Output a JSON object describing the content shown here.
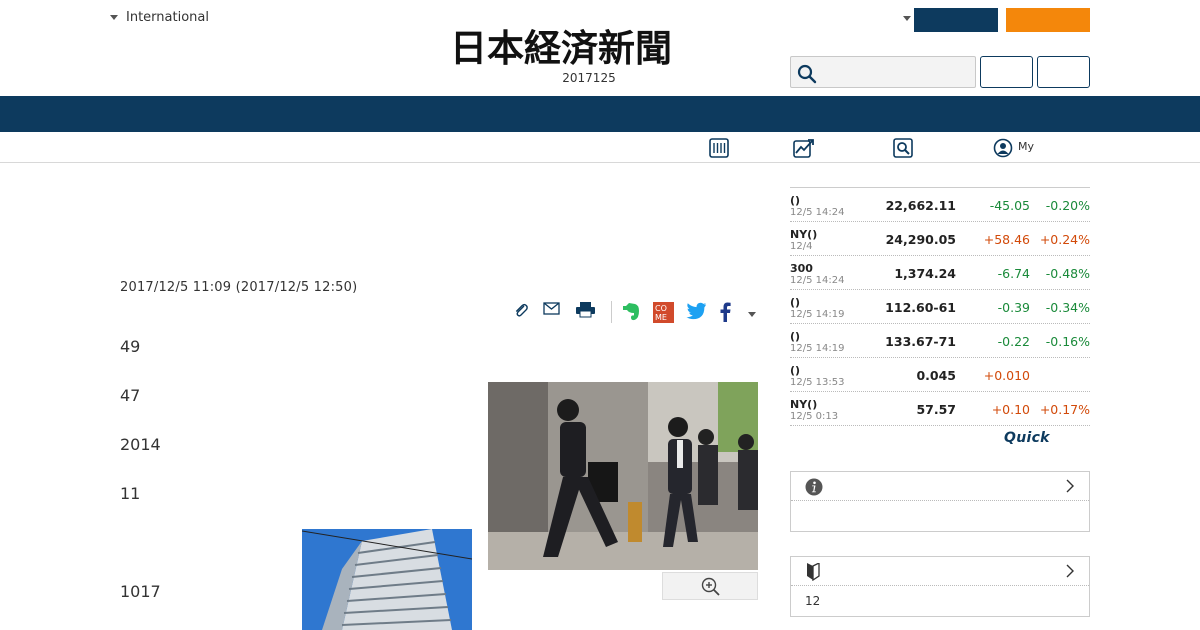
{
  "header": {
    "region_selector": "International",
    "date": "2017125",
    "logo_alt": "日本経済新聞",
    "login_button": "",
    "signup_button": "",
    "search_placeholder": "",
    "button_a": "",
    "button_b": ""
  },
  "subnav": {
    "my_label": "My"
  },
  "article": {
    "timestamp": "2017/12/5 11:09 (2017/12/5 12:50)",
    "paragraphs": [
      "49",
      "47",
      "2014",
      "11",
      "1017"
    ]
  },
  "share_icons": [
    "clip-icon",
    "mail-icon",
    "print-icon",
    "evernote-icon",
    "come-icon",
    "twitter-icon",
    "facebook-icon"
  ],
  "market": {
    "rows": [
      {
        "name": "()",
        "time": "12/5 14:24",
        "value": "22,662.11",
        "change": "-45.05",
        "pct": "-0.20%",
        "dir": "neg"
      },
      {
        "name": "NY()",
        "time": "12/4",
        "value": "24,290.05",
        "change": "+58.46",
        "pct": "+0.24%",
        "dir": "pos"
      },
      {
        "name": "300",
        "time": "12/5 14:24",
        "value": "1,374.24",
        "change": "-6.74",
        "pct": "-0.48%",
        "dir": "neg"
      },
      {
        "name": "()",
        "time": "12/5 14:19",
        "value": "112.60-61",
        "change": "-0.39",
        "pct": "-0.34%",
        "dir": "neg"
      },
      {
        "name": "()",
        "time": "12/5 14:19",
        "value": "133.67-71",
        "change": "-0.22",
        "pct": "-0.16%",
        "dir": "neg"
      },
      {
        "name": "()",
        "time": "12/5 13:53",
        "value": "0.045",
        "change": "+0.010",
        "pct": "",
        "dir": "pos"
      },
      {
        "name": "NY()",
        "time": "12/5 0:13",
        "value": "57.57",
        "change": "+0.10",
        "pct": "+0.17%",
        "dir": "pos"
      }
    ],
    "source_logo": "Quick"
  },
  "panels": {
    "panel1_body": "",
    "panel2_body": "12"
  },
  "colors": {
    "navy": "#0d3a5e",
    "orange": "#f4870b",
    "negative": "#1a8a3a",
    "positive": "#d24a0a"
  }
}
